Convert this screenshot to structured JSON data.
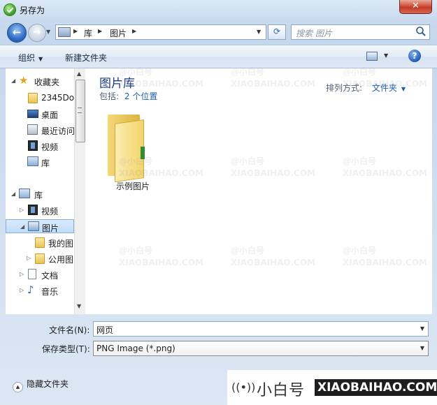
{
  "window": {
    "title": "另存为",
    "close_label": "✕"
  },
  "nav": {
    "back_label": "←",
    "forward_label": "→",
    "breadcrumb": [
      "库",
      "图片"
    ],
    "search_placeholder": "搜索 图片",
    "refresh_label": "⟳"
  },
  "toolbar": {
    "organize_label": "组织",
    "new_folder_label": "新建文件夹",
    "help_label": "?"
  },
  "sidebar": {
    "items": [
      {
        "label": "收藏夹"
      },
      {
        "label": "2345Do"
      },
      {
        "label": "桌面"
      },
      {
        "label": "最近访问"
      },
      {
        "label": "视频"
      },
      {
        "label": "库"
      },
      {
        "label": "库"
      },
      {
        "label": "视频"
      },
      {
        "label": "图片"
      },
      {
        "label": "我的图"
      },
      {
        "label": "公用图"
      },
      {
        "label": "文档"
      },
      {
        "label": "音乐"
      }
    ]
  },
  "content": {
    "title": "图片库",
    "includes_label": "包括:",
    "includes_link": "2 个位置",
    "arrange_label": "排列方式:",
    "arrange_value": "文件夹",
    "items": [
      {
        "label": "示例图片"
      }
    ]
  },
  "form": {
    "filename_label": "文件名(N):",
    "filename_value": "网页",
    "filetype_label": "保存类型(T):",
    "filetype_value": "PNG Image (*.png)"
  },
  "footer": {
    "hide_folders_label": "隐藏文件夹"
  },
  "watermark": {
    "brand_name": "小白号",
    "site": "XIAOBAIHAO.COM",
    "tile_text": "@小白号",
    "tile_site": "XIAOBAIHAO.COM"
  },
  "colors": {
    "accent": "#1a5fb4",
    "title_blue": "#1e3a8a",
    "close_red": "#c23a26"
  }
}
